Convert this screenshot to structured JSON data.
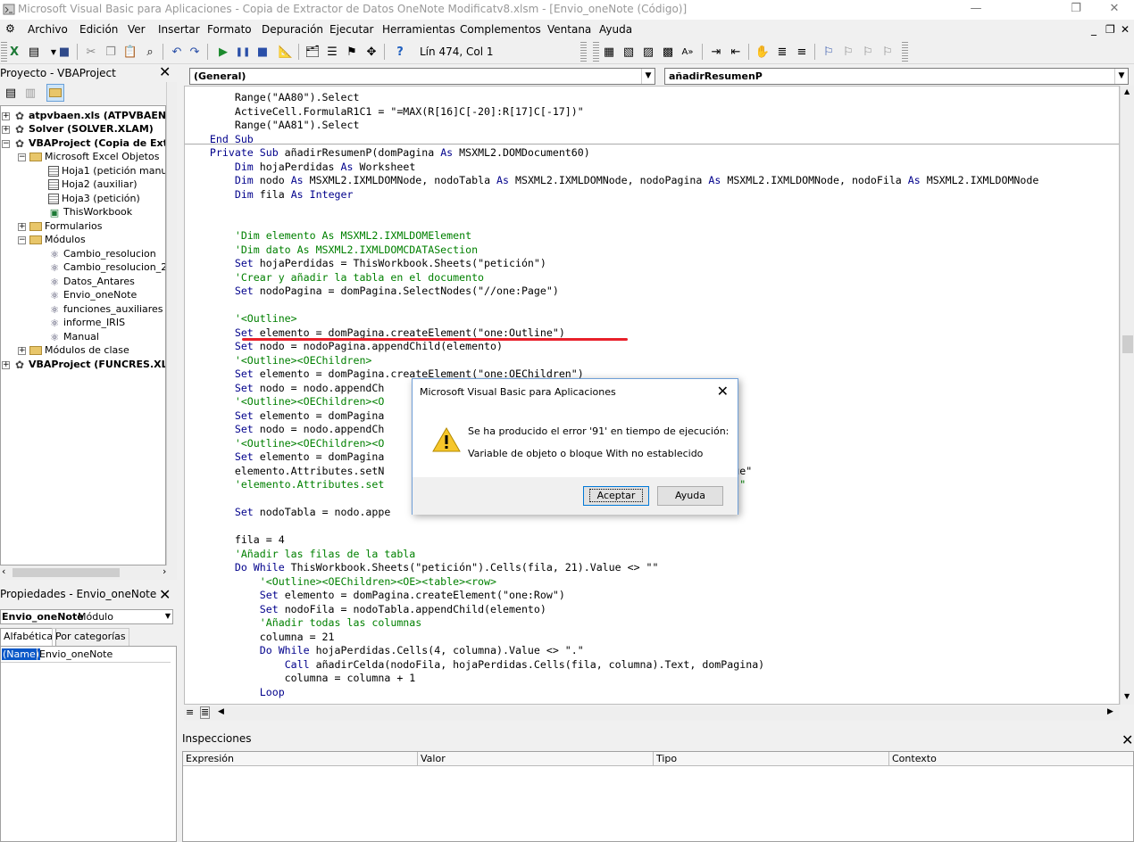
{
  "window": {
    "title": "Microsoft Visual Basic para Aplicaciones - Copia de Extractor de Datos OneNote Modificatv8.xlsm - [Envio_oneNote (Código)]",
    "minimize": "—",
    "restore": "❐",
    "close": "✕"
  },
  "menu": {
    "items": [
      "Archivo",
      "Edición",
      "Ver",
      "Insertar",
      "Formato",
      "Depuración",
      "Ejecutar",
      "Herramientas",
      "Complementos",
      "Ventana",
      "Ayuda"
    ],
    "mdi_min": "_",
    "mdi_restore": "❐",
    "mdi_close": "✕"
  },
  "toolbar": {
    "position": "Lín 474, Col 1"
  },
  "project": {
    "title": "Proyecto - VBAProject",
    "items": [
      {
        "label": "atpvbaen.xls (ATPVBAEN.XLA",
        "bold": true
      },
      {
        "label": "Solver (SOLVER.XLAM)",
        "bold": true
      },
      {
        "label": "VBAProject (Copia de Extrac",
        "bold": true
      },
      {
        "label": "Microsoft Excel Objetos",
        "bold": false
      },
      {
        "label": "Hoja1 (petición manual)",
        "bold": false
      },
      {
        "label": "Hoja2 (auxiliar)",
        "bold": false
      },
      {
        "label": "Hoja3 (petición)",
        "bold": false
      },
      {
        "label": "ThisWorkbook",
        "bold": false
      },
      {
        "label": "Formularios",
        "bold": false
      },
      {
        "label": "Módulos",
        "bold": false
      },
      {
        "label": "Cambio_resolucion",
        "bold": false
      },
      {
        "label": "Cambio_resolucion_2",
        "bold": false
      },
      {
        "label": "Datos_Antares",
        "bold": false
      },
      {
        "label": "Envio_oneNote",
        "bold": false
      },
      {
        "label": "funciones_auxiliares",
        "bold": false
      },
      {
        "label": "informe_IRIS",
        "bold": false
      },
      {
        "label": "Manual",
        "bold": false
      },
      {
        "label": "Módulos de clase",
        "bold": false
      },
      {
        "label": "VBAProject (FUNCRES.XLAM)",
        "bold": true
      }
    ]
  },
  "properties": {
    "title": "Propiedades - Envio_oneNote",
    "object_name": "Envio_oneNote",
    "object_type": "Módulo",
    "tabs": [
      "Alfabética",
      "Por categorías"
    ],
    "row_name": "(Name)",
    "row_value": "Envio_oneNote"
  },
  "code": {
    "object_combo": "(General)",
    "proc_combo": "añadirResumenP",
    "lines": [
      "        Range(\"AA80\").Select",
      "        ActiveCell.FormulaR1C1 = \"=MAX(R[16]C[-20]:R[17]C[-17])\"",
      "        Range(\"AA81\").Select",
      "    End Sub",
      "    Private Sub añadirResumenP(domPagina As MSXML2.DOMDocument60)",
      "        Dim hojaPerdidas As Worksheet",
      "        Dim nodo As MSXML2.IXMLDOMNode, nodoTabla As MSXML2.IXMLDOMNode, nodoPagina As MSXML2.IXMLDOMNode, nodoFila As MSXML2.IXMLDOMNode",
      "        Dim fila As Integer",
      "",
      "",
      "        'Dim elemento As MSXML2.IXMLDOMElement",
      "        'Dim dato As MSXML2.IXMLDOMCDATASection",
      "        Set hojaPerdidas = ThisWorkbook.Sheets(\"petición\")",
      "        'Crear y añadir la tabla en el documento",
      "        Set nodoPagina = domPagina.SelectNodes(\"//one:Page\")",
      "",
      "        '<Outline>",
      "        Set elemento = domPagina.createElement(\"one:Outline\")",
      "        Set nodo = nodoPagina.appendChild(elemento)",
      "        '<Outline><OEChildren>",
      "        Set elemento = domPagina.createElement(\"one:OEChildren\")",
      "        Set nodo = nodo.appendCh",
      "        '<Outline><OEChildren><O",
      "        Set elemento = domPagina",
      "        Set nodo = nodo.appendCh",
      "        '<Outline><OEChildren><O",
      "        Set elemento = domPagina",
      "        elemento.Attributes.setN                                     sible\")).Text = \"true\"",
      "        'elemento.Attributes.set                                     \")).Text = \"perdidas\"",
      "",
      "        Set nodoTabla = nodo.appe",
      "",
      "        fila = 4",
      "        'Añadir las filas de la tabla",
      "        Do While ThisWorkbook.Sheets(\"petición\").Cells(fila, 21).Value <> \"\"",
      "            '<Outline><OEChildren><OE><table><row>",
      "            Set elemento = domPagina.createElement(\"one:Row\")",
      "            Set nodoFila = nodoTabla.appendChild(elemento)",
      "            'Añadir todas las columnas",
      "            columna = 21",
      "            Do While hojaPerdidas.Cells(4, columna).Value <> \".\"",
      "                Call añadirCelda(nodoFila, hojaPerdidas.Cells(fila, columna).Text, domPagina)",
      "                columna = columna + 1",
      "            Loop"
    ]
  },
  "inspections": {
    "title": "Inspecciones",
    "columns": [
      "Expresión",
      "Valor",
      "Tipo",
      "Contexto"
    ]
  },
  "dialog": {
    "title": "Microsoft Visual Basic para Aplicaciones",
    "message1": "Se ha producido el error '91' en tiempo de ejecución:",
    "message2": "Variable de objeto o bloque With no establecido",
    "ok": "Aceptar",
    "help": "Ayuda"
  },
  "colors": {
    "keyword": "#00008b",
    "comment": "#008000",
    "underline": "#e8202a"
  }
}
